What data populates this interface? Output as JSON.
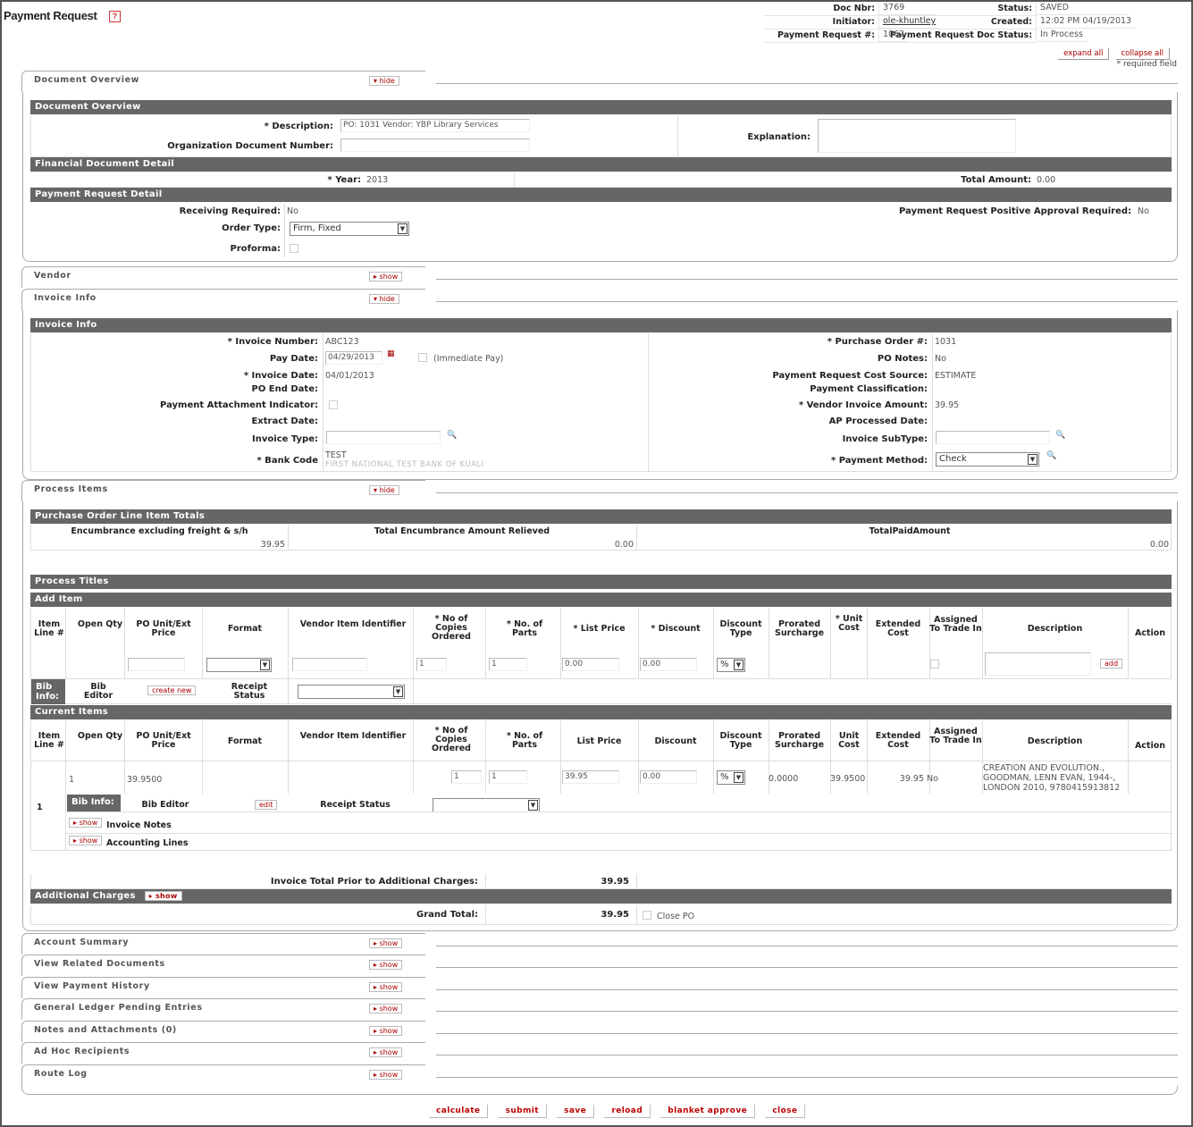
{
  "page": {
    "title": "Payment Request",
    "help": "?"
  },
  "header": {
    "doc_nbr_label": "Doc Nbr:",
    "doc_nbr": "3769",
    "status_label": "Status:",
    "status": "SAVED",
    "initiator_label": "Initiator:",
    "initiator": "ole-khuntley",
    "created_label": "Created:",
    "created": "12:02 PM 04/19/2013",
    "pr_num_label": "Payment Request #:",
    "pr_num": "1062",
    "pr_doc_status_label": "Payment Request Doc Status:",
    "pr_doc_status": "In Process"
  },
  "top": {
    "expand_all": "expand all",
    "collapse_all": "collapse all",
    "required_note": "* required field"
  },
  "tabs": {
    "doc_overview": {
      "label": "Document Overview",
      "toggle": "hide"
    },
    "vendor": {
      "label": "Vendor",
      "toggle": "show"
    },
    "invoice_info": {
      "label": "Invoice Info",
      "toggle": "hide"
    },
    "process_items": {
      "label": "Process Items",
      "toggle": "hide"
    },
    "account_summary": {
      "label": "Account Summary",
      "toggle": "show"
    },
    "related_docs": {
      "label": "View Related Documents",
      "toggle": "show"
    },
    "payment_history": {
      "label": "View Payment History",
      "toggle": "show"
    },
    "gl_entries": {
      "label": "General Ledger Pending Entries",
      "toggle": "show"
    },
    "notes": {
      "label": "Notes and Attachments (0)",
      "toggle": "show"
    },
    "adhoc": {
      "label": "Ad Hoc Recipients",
      "toggle": "show"
    },
    "route_log": {
      "label": "Route Log",
      "toggle": "show"
    }
  },
  "doc_overview": {
    "section": "Document Overview",
    "description_label": "* Description:",
    "description": "PO: 1031 Vendor: YBP Library Services",
    "org_doc_label": "Organization Document Number:",
    "org_doc": "",
    "explanation_label": "Explanation:",
    "explanation": "",
    "fin_section": "Financial Document Detail",
    "year_label": "* Year:",
    "year": "2013",
    "total_label": "Total Amount:",
    "total": "0.00",
    "prd_section": "Payment Request Detail",
    "receiving_label": "Receiving Required:",
    "receiving": "No",
    "positive_label": "Payment Request Positive Approval Required:",
    "positive": "No",
    "order_type_label": "Order Type:",
    "order_type": "Firm, Fixed",
    "proforma_label": "Proforma:"
  },
  "invoice": {
    "section": "Invoice Info",
    "invoice_number_label": "* Invoice Number:",
    "invoice_number": "ABC123",
    "po_label": "* Purchase Order #:",
    "po": "1031",
    "pay_date_label": "Pay Date:",
    "pay_date": "04/29/2013",
    "immediate_pay": "(Immediate Pay)",
    "po_notes_label": "PO Notes:",
    "po_notes": "No",
    "invoice_date_label": "* Invoice Date:",
    "invoice_date": "04/01/2013",
    "cost_source_label": "Payment Request Cost Source:",
    "cost_source": "ESTIMATE",
    "po_end_label": "PO End Date:",
    "classification_label": "Payment Classification:",
    "attachment_label": "Payment Attachment Indicator:",
    "vendor_amount_label": "* Vendor Invoice Amount:",
    "vendor_amount": "39.95",
    "extract_label": "Extract Date:",
    "ap_processed_label": "AP Processed Date:",
    "invoice_type_label": "Invoice Type:",
    "invoice_subtype_label": "Invoice SubType:",
    "bank_label": "* Bank Code",
    "bank_code": "TEST",
    "bank_name": "FIRST NATIONAL TEST BANK OF KUALI",
    "method_label": "* Payment Method:",
    "method": "Check"
  },
  "totals": {
    "section": "Purchase Order Line Item Totals",
    "h1": "Encumbrance excluding freight & s/h",
    "v1": "39.95",
    "h2": "Total Encumbrance Amount Relieved",
    "v2": "0.00",
    "h3": "TotalPaidAmount",
    "v3": "0.00"
  },
  "process": {
    "titles": "Process Titles",
    "add_item": "Add Item",
    "current_items": "Current Items",
    "cols": [
      "Item Line #",
      "Open Qty",
      "PO Unit/Ext Price",
      "Format",
      "Vendor Item Identifier",
      "* No of Copies Ordered",
      "* No. of Parts",
      "* List Price",
      "* Discount",
      "Discount Type",
      "Prorated Surcharge",
      "* Unit Cost",
      "Extended Cost",
      "Assigned To Trade In",
      "Description",
      "Action"
    ],
    "cur_cols": [
      "Item Line #",
      "Open Qty",
      "PO Unit/Ext Price",
      "Format",
      "Vendor Item Identifier",
      "* No of Copies Ordered",
      "* No. of Parts",
      "List Price",
      "Discount",
      "Discount Type",
      "Prorated Surcharge",
      "Unit Cost",
      "Extended Cost",
      "Assigned To Trade In",
      "Description",
      "Action"
    ],
    "add": {
      "copies": "1",
      "parts": "1",
      "list_price": "0.00",
      "discount": "0.00",
      "disc_type": "%",
      "add_btn": "add"
    },
    "bib": {
      "bib_info": "Bib Info:",
      "bib_editor": "Bib Editor",
      "create_new": "create new",
      "receipt_status": "Receipt Status"
    },
    "item": {
      "line": "1",
      "open_qty": "1",
      "unit_price": "39.9500",
      "copies": "1",
      "parts": "1",
      "list_price": "39.95",
      "discount": "0.00",
      "disc_type": "%",
      "surcharge": "0.0000",
      "unit_cost": "39.9500",
      "extended": "39.95",
      "trade_in": "No",
      "description": "CREATION AND EVOLUTION., GOODMAN, LENN EVAN, 1944-, LONDON 2010, 9780415913812",
      "bib_info": "Bib Info:",
      "bib_editor": "Bib Editor",
      "edit": "edit",
      "receipt_status": "Receipt Status",
      "invoice_notes": "Invoice Notes",
      "accounting_lines": "Accounting Lines",
      "show": "show"
    },
    "invoice_total_label": "Invoice Total Prior to Additional Charges:",
    "invoice_total": "39.95",
    "additional_charges": "Additional Charges",
    "show": "show",
    "grand_total_label": "Grand Total:",
    "grand_total": "39.95",
    "close_po": "Close PO"
  },
  "bottom": [
    "calculate",
    "submit",
    "save",
    "reload",
    "blanket approve",
    "close"
  ]
}
